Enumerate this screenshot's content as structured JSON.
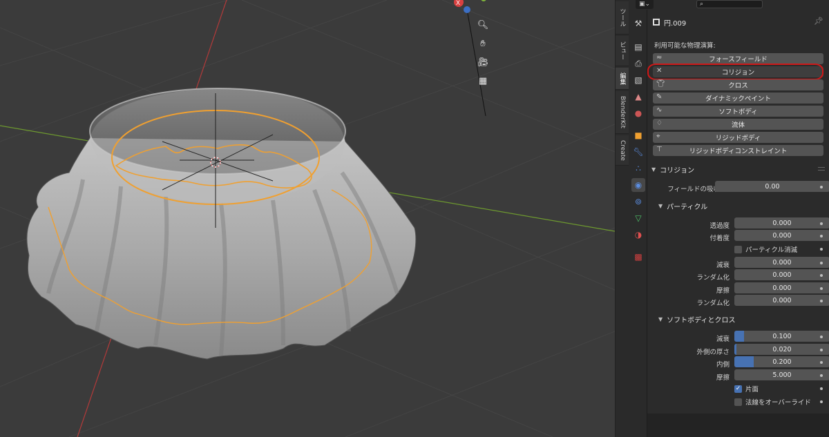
{
  "viewport": {
    "gizmo_x_label": "X",
    "nav_icons": [
      "zoom-icon",
      "pan-hand-icon",
      "camera-icon",
      "ortho-grid-icon"
    ]
  },
  "side_tabs": [
    "ツール",
    "ビュー",
    "編集",
    "BlenderKit",
    "Create"
  ],
  "properties": {
    "header_search_placeholder": "",
    "object_name": "円.009",
    "available_physics_label": "利用可能な物理演算:",
    "physics_buttons": [
      {
        "label": "フォースフィールド",
        "icon": "forcefield-icon",
        "added": false
      },
      {
        "label": "コリジョン",
        "icon": "close-icon",
        "added": true
      },
      {
        "label": "クロス",
        "icon": "cloth-icon",
        "added": false
      },
      {
        "label": "ダイナミックペイント",
        "icon": "brush-icon",
        "added": false
      },
      {
        "label": "ソフトボディ",
        "icon": "softbody-icon",
        "added": false
      },
      {
        "label": "流体",
        "icon": "fluid-drop-icon",
        "added": false
      },
      {
        "label": "リジッドボディ",
        "icon": "rigidbody-icon",
        "added": false
      },
      {
        "label": "リジッドボディコンストレイント",
        "icon": "constraint-icon",
        "added": false
      }
    ],
    "collision": {
      "title": "コリジョン",
      "field_absorption_label": "フィールドの吸収",
      "field_absorption_value": "0.00",
      "particle": {
        "title": "パーティクル",
        "permeability_label": "透過度",
        "permeability_value": "0.000",
        "stickiness_label": "付着度",
        "stickiness_value": "0.000",
        "kill_particles_label": "パーティクル消滅",
        "kill_particles_checked": false,
        "damping_label": "減衰",
        "damping_value": "0.000",
        "damping_random_label": "ランダム化",
        "damping_random_value": "0.000",
        "friction_label": "摩擦",
        "friction_value": "0.000",
        "friction_random_label": "ランダム化",
        "friction_random_value": "0.000"
      },
      "softbody_cloth": {
        "title": "ソフトボディとクロス",
        "damping_label": "減衰",
        "damping_value": "0.100",
        "damping_fraction": 0.1,
        "outer_label": "外側の厚さ",
        "outer_value": "0.020",
        "outer_fraction": 0.02,
        "inner_label": "内側",
        "inner_value": "0.200",
        "inner_fraction": 0.2,
        "friction_label": "摩擦",
        "friction_value": "5.000",
        "single_sided_label": "片面",
        "single_sided_checked": true,
        "override_normals_label": "法線をオーバーライド",
        "override_normals_checked": false
      }
    }
  },
  "colors": {
    "accent": "#4772b3",
    "highlight": "#d01818",
    "selection": "#f0a030",
    "x_axis": "#b33a3a",
    "y_axis": "#6e9a2f"
  }
}
